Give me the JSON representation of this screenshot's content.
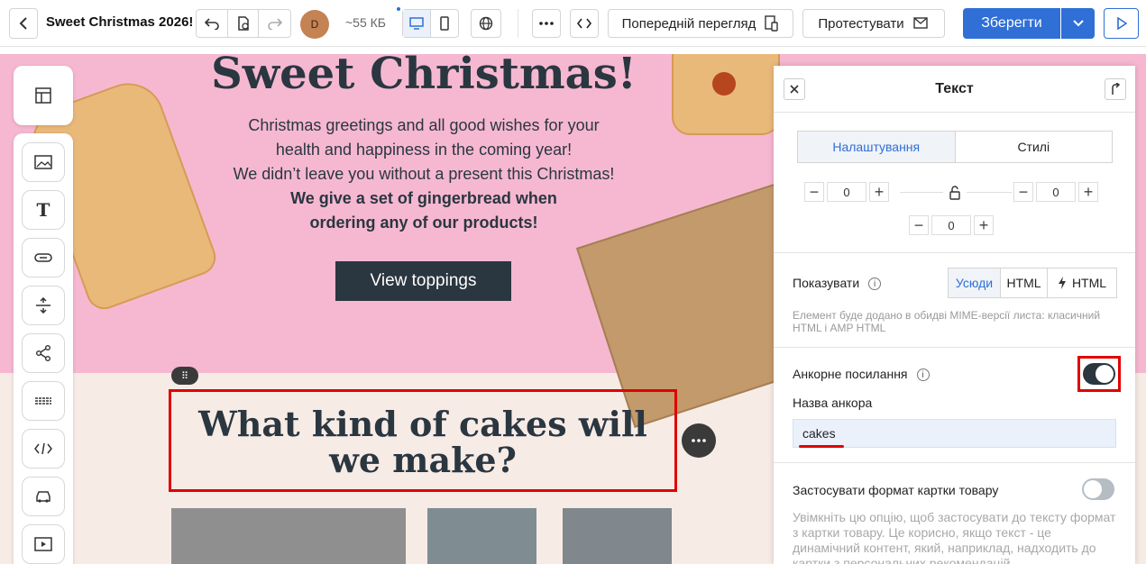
{
  "topbar": {
    "title": "Sweet Christmas 2026!",
    "avatar_initial": "D",
    "size": "~55 КБ",
    "preview_label": "Попередній перегляд",
    "test_label": "Протестувати",
    "save_label": "Зберегти"
  },
  "email": {
    "hero_title": "Sweet Christmas!",
    "hero_line1": "Christmas greetings and all good wishes for your",
    "hero_line2": "health and happiness in the coming year!",
    "hero_line3": "We didn’t leave you without a present this Christmas!",
    "hero_line4": "We give a set of gingerbread when",
    "hero_line5": "ordering any of our products!",
    "hero_button": "View toppings",
    "cakes_title": "What kind of cakes will we make?"
  },
  "panel": {
    "title": "Текст",
    "tab_settings": "Налаштування",
    "tab_styles": "Стилі",
    "padding_top": "0",
    "padding_left": "0",
    "padding_right": "0",
    "padding_bottom": "0",
    "show_label": "Показувати",
    "show_all": "Усюди",
    "show_html": "HTML",
    "show_amp": "HTML",
    "show_hint": "Елемент буде додано в обидві MIME-версії листа: класичний HTML і AMP HTML",
    "anchor_label": "Анкорне посилання",
    "anchor_name_label": "Назва анкора",
    "anchor_value": "cakes",
    "product_card_label": "Застосувати формат картки товару",
    "product_card_hint": "Увімкніть цю опцію, щоб застосувати до тексту формат з картки товару. Це корисно, якщо текст - це динамічний контент, який, наприклад, надходить до картки з персональних рекомендацій."
  }
}
